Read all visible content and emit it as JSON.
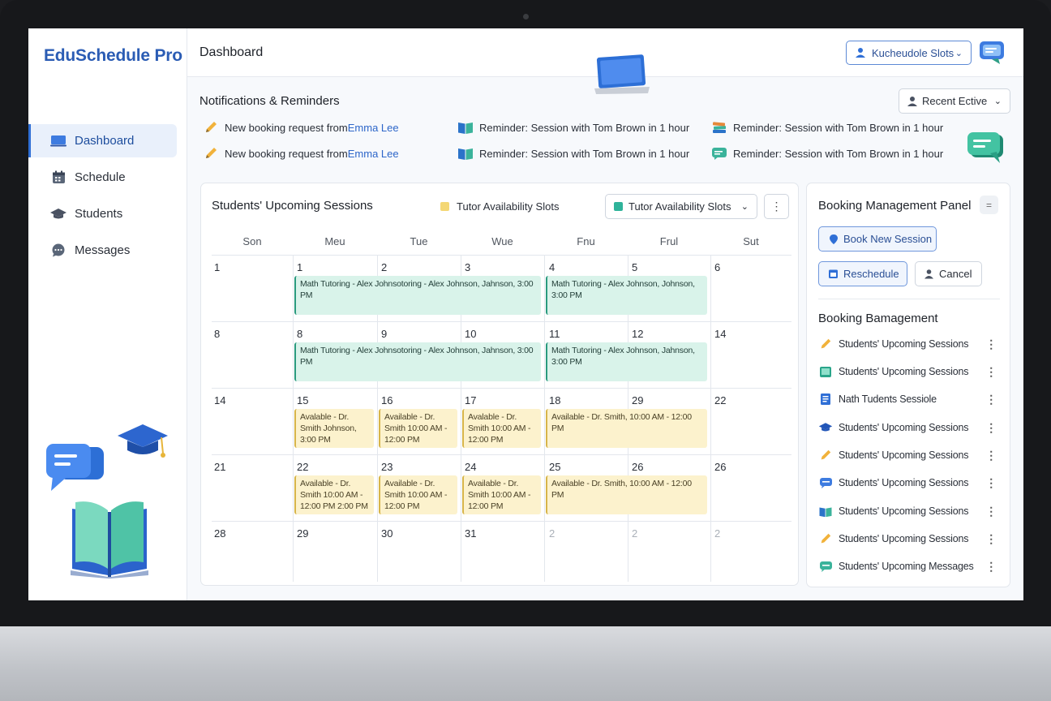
{
  "app": {
    "title": "EduSchedule Pro"
  },
  "sidebar": {
    "items": [
      {
        "label": "Dashboard",
        "icon": "monitor-icon",
        "active": true
      },
      {
        "label": "Schedule",
        "icon": "calendar-icon"
      },
      {
        "label": "Students",
        "icon": "graduation-cap-icon"
      },
      {
        "label": "Messages",
        "icon": "chat-icon"
      }
    ]
  },
  "header": {
    "title": "Dashboard",
    "slots_button": "Kucheudole Slots"
  },
  "notifications": {
    "title": "Notifications & Reminders",
    "recent_button": "Recent Ective",
    "items": [
      {
        "text": "New booking request from ",
        "link": "Emma Lee"
      },
      {
        "text": "New booking request from ",
        "link": "Emma Lee"
      },
      {
        "text": "Reminder: Session with Tom Brown in 1 hour"
      },
      {
        "text": "Reminder: Session with Tom Brown in 1 hour"
      },
      {
        "text": "Reminder: Session with Tom Brown in 1 hour"
      },
      {
        "text": "Reminder: Session with Tom Brown in 1 hour"
      }
    ]
  },
  "calendar": {
    "title": "Students' Upcoming Sessions",
    "legend": "Tutor Availability Slots",
    "select": "Tutor Availability Slots",
    "more": "⋮",
    "days": [
      "Son",
      "Meu",
      "Tue",
      "Wue",
      "Fnu",
      "Frul",
      "Sut"
    ],
    "weeks": [
      [
        "1",
        "1",
        "2",
        "3",
        "4",
        "5",
        "6"
      ],
      [
        "8",
        "8",
        "9",
        "10",
        "11",
        "12",
        "14"
      ],
      [
        "14",
        "15",
        "16",
        "17",
        "18",
        "29",
        "22"
      ],
      [
        "21",
        "22",
        "23",
        "24",
        "25",
        "26",
        "26"
      ],
      [
        "28",
        "29",
        "30",
        "31",
        "2",
        "2",
        "2"
      ]
    ],
    "events": {
      "w1a": "Math Tutoring - Alex Johnsotoring - Alex Johnson, Jahnson, 3:00 PM",
      "w1b": "Math Tutoring - Alex Johnson, Johnson, 3:00 PM",
      "w2a": "Math Tutoring - Alex Johnsotoring - Alex Johnson, Jahnson, 3:00 PM",
      "w2b": "Math Tutoring - Alex Johnson, Jahnson, 3:00 PM",
      "w3_mon": "Avalable - Dr. Smith Johnson, 3:00 PM",
      "w3_tue": "Available - Dr. Smith 10:00 AM - 12:00 PM",
      "w3_wed": "Avalable - Dr. Smith 10:00 AM - 12:00 PM",
      "w3_thu": "Available - Dr. Smith, 10:00 AM - 12:00 PM",
      "w4_mon": "Available - Dr. Smith 10:00 AM - 12:00 PM 2:00 PM",
      "w4_tue": "Available - Dr. Smith 10:00 AM - 12:00 PM",
      "w4_wed": "Available - Dr. Smith 10:00 AM - 12:00 PM",
      "w4_thu": "Available - Dr. Smith, 10:00 AM - 12:00 PM"
    }
  },
  "panel": {
    "title": "Booking Management Panel",
    "menu": "=",
    "book_button": "Book New Session",
    "reschedule_button": "Reschedule",
    "cancel_button": "Cancel",
    "subtitle": "Booking Bamagement",
    "items": [
      {
        "label": "Students' Upcoming Sessions",
        "icon": "pencil-icon"
      },
      {
        "label": "Students' Upcoming Sessions",
        "icon": "book-icon"
      },
      {
        "label": "Nath Tudents Sessiole",
        "icon": "notebook-icon"
      },
      {
        "label": "Students' Upcoming Sessions",
        "icon": "graduation-cap-icon"
      },
      {
        "label": "Students' Upcoming Sessions",
        "icon": "pencil-icon"
      },
      {
        "label": "Students' Upcoming Sessions",
        "icon": "chat-icon"
      },
      {
        "label": "Students' Upcoming Sessions",
        "icon": "book-icon"
      },
      {
        "label": "Students' Upcoming Sessions",
        "icon": "pencil-icon"
      },
      {
        "label": "Students' Upcoming Messages",
        "icon": "chat-icon"
      }
    ]
  },
  "colors": {
    "accent": "#2f6fd6",
    "session_green": "#d9f3ea",
    "availability_yellow": "#fcf2cd"
  }
}
